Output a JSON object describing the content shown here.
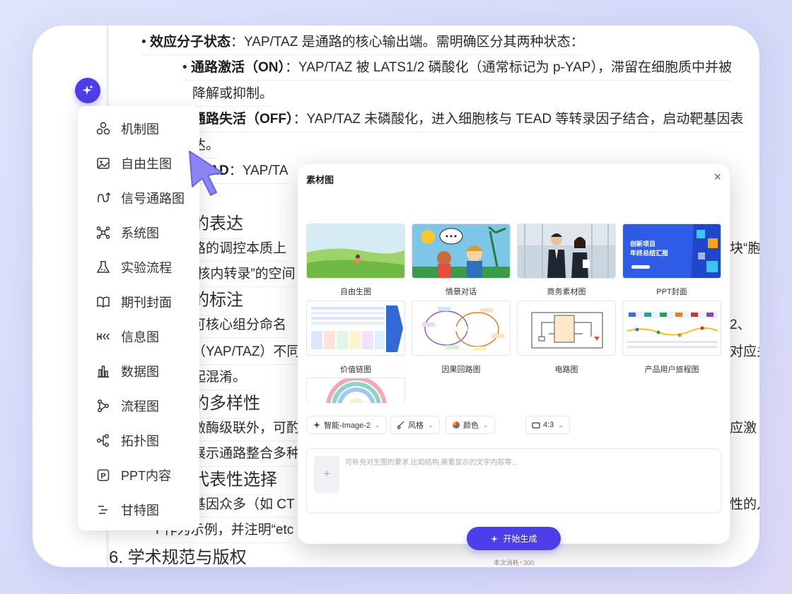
{
  "document": {
    "lines": [
      {
        "bullet": "•",
        "bold": "效应分子状态",
        "rest": "：YAP/TAZ 是通路的核心输出端。需明确区分其两种状态："
      },
      {
        "bullet": "•",
        "bold": "通路激活（ON）",
        "rest": "：YAP/TAZ 被 LATS1/2 磷酸化（通常标记为 p-YAP），滞留在细胞质中并被"
      },
      {
        "bullet": "",
        "bold": "",
        "rest": "降解或抑制。"
      },
      {
        "bullet": "",
        "bold": "通路失活（OFF）",
        "rest": "：YAP/TAZ 未磷酸化，进入细胞核与 TEAD 等转录因子结合，启动靶基因表"
      },
      {
        "bullet": "",
        "bold": "",
        "rest": "达。"
      },
      {
        "bullet": "",
        "bold": "TEAD",
        "rest": "：YAP/TA"
      },
      {
        "bullet": "",
        "bold": "",
        "rest": "。"
      },
      {
        "bullet": "",
        "bold": "",
        "rest": "的表达"
      },
      {
        "bullet": "",
        "bold": "",
        "rest": "路的调控本质上"
      },
      {
        "bullet": "",
        "bold": "",
        "rest": "“核内转录”的空间"
      },
      {
        "bullet": "",
        "bold": "",
        "rest": "的标注"
      },
      {
        "bullet": "",
        "bold": "",
        "rest": "可核心组分命名"
      },
      {
        "bullet": "",
        "bold": "",
        "rest": "（YAP/TAZ）不同"
      },
      {
        "bullet": "",
        "bold": "",
        "rest": "起混淆。"
      },
      {
        "bullet": "",
        "bold": "",
        "rest": "的多样性"
      },
      {
        "bullet": "",
        "bold": "",
        "rest": "激酶级联外，可酌"
      },
      {
        "bullet": "",
        "bold": "",
        "rest": "展示通路整合多种"
      },
      {
        "bullet": "",
        "bold": "",
        "rest": "代表性选择"
      },
      {
        "bullet": "",
        "bold": "",
        "rest": "基因众多（如 CT"
      },
      {
        "bullet": "",
        "bold": "",
        "rest": "F作为示例，并注明“etc"
      },
      {
        "bullet": "",
        "bold": "",
        "rest": "6. 学术规范与版权"
      }
    ],
    "right_fragments": [
      "块“胞质",
      "2、",
      "对应关",
      "应激",
      "性的几"
    ]
  },
  "menu": {
    "items": [
      {
        "label": "机制图",
        "icon": "mechanism-icon"
      },
      {
        "label": "自由生图",
        "icon": "image-icon"
      },
      {
        "label": "信号通路图",
        "icon": "pathway-icon"
      },
      {
        "label": "系统图",
        "icon": "system-icon"
      },
      {
        "label": "实验流程",
        "icon": "flask-icon"
      },
      {
        "label": "期刊封面",
        "icon": "book-icon"
      },
      {
        "label": "信息图",
        "icon": "infographic-icon"
      },
      {
        "label": "数据图",
        "icon": "bar-chart-icon"
      },
      {
        "label": "流程图",
        "icon": "flowchart-icon"
      },
      {
        "label": "拓扑图",
        "icon": "topology-icon"
      },
      {
        "label": "PPT内容",
        "icon": "ppt-icon"
      },
      {
        "label": "甘特图",
        "icon": "gantt-icon"
      }
    ]
  },
  "dialog": {
    "title": "素材图",
    "close": "×",
    "tiles": [
      {
        "label": "自由生图"
      },
      {
        "label": "情景对话"
      },
      {
        "label": "商务素材图"
      },
      {
        "label": "PPT封面"
      },
      {
        "label": "价值链图"
      },
      {
        "label": "因果回路图"
      },
      {
        "label": "电路图"
      },
      {
        "label": "产品用户旅程图"
      },
      {
        "label": ""
      }
    ],
    "ppt_cover": {
      "line1": "创新项目",
      "line2": "年终总结汇报"
    },
    "options": {
      "model": "智能-Image-2",
      "style": "风格",
      "color": "颜色",
      "ratio": "4:3"
    },
    "prompt_placeholder": "可补充对生图的要求,比如结构,需要显示的文字内容等...",
    "add_symbol": "+",
    "generate_label": "开始生成",
    "cost_label": "本次消耗",
    "cost_value": "300"
  },
  "colors": {
    "accent": "#4c3ee8",
    "bg": "#dfe4fb"
  }
}
